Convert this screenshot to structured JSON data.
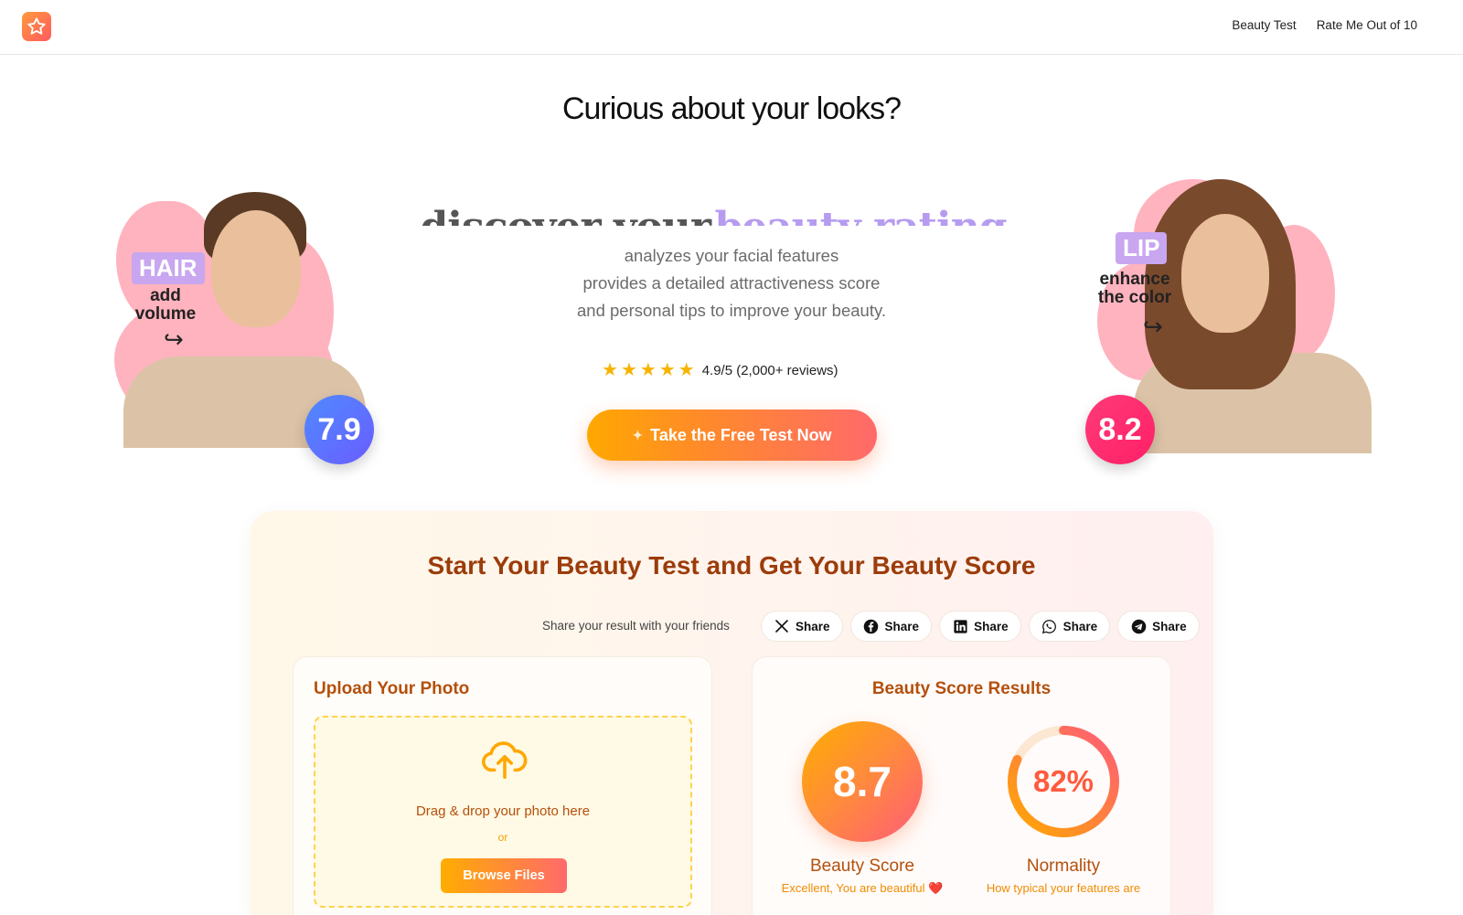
{
  "header": {
    "logo_icon": "star-icon",
    "nav": [
      "Beauty Test",
      "Rate Me Out of 10"
    ]
  },
  "hero": {
    "title": "Curious about your looks?",
    "subtitle_part1": "discover your",
    "subtitle_part2": "beauty rating",
    "description": [
      "analyzes your facial features",
      "provides a detailed attractiveness score",
      "and personal tips to improve your beauty."
    ],
    "rating": {
      "stars": 5,
      "text": "4.9/5 (2,000+ reviews)"
    },
    "cta_label": "Take the Free Test Now",
    "left_example": {
      "tag": "HAIR",
      "note_line1": "add",
      "note_line2": "volume",
      "score": "7.9",
      "score_color": "#5b7cff"
    },
    "right_example": {
      "tag": "LIP",
      "note_line1": "enhance",
      "note_line2": "the color",
      "score": "8.2",
      "score_color": "#ff2d6f"
    }
  },
  "test_card": {
    "title": "Start Your Beauty Test and Get Your Beauty Score",
    "share_label": "Share your result with your friends",
    "share_buttons": [
      {
        "icon": "x-icon",
        "label": "Share"
      },
      {
        "icon": "facebook-icon",
        "label": "Share"
      },
      {
        "icon": "linkedin-icon",
        "label": "Share"
      },
      {
        "icon": "whatsapp-icon",
        "label": "Share"
      },
      {
        "icon": "telegram-icon",
        "label": "Share"
      }
    ],
    "upload": {
      "title": "Upload Your Photo",
      "drop_text": "Drag & drop your photo here",
      "or_text": "or",
      "browse_label": "Browse Files"
    },
    "results": {
      "title": "Beauty Score Results",
      "beauty_score": {
        "value": "8.7",
        "label": "Beauty Score",
        "sub": "Excellent, You are beautiful ❤️"
      },
      "normality": {
        "value": "82%",
        "percent": 82,
        "label": "Normality",
        "sub": "How typical your features are"
      }
    }
  }
}
